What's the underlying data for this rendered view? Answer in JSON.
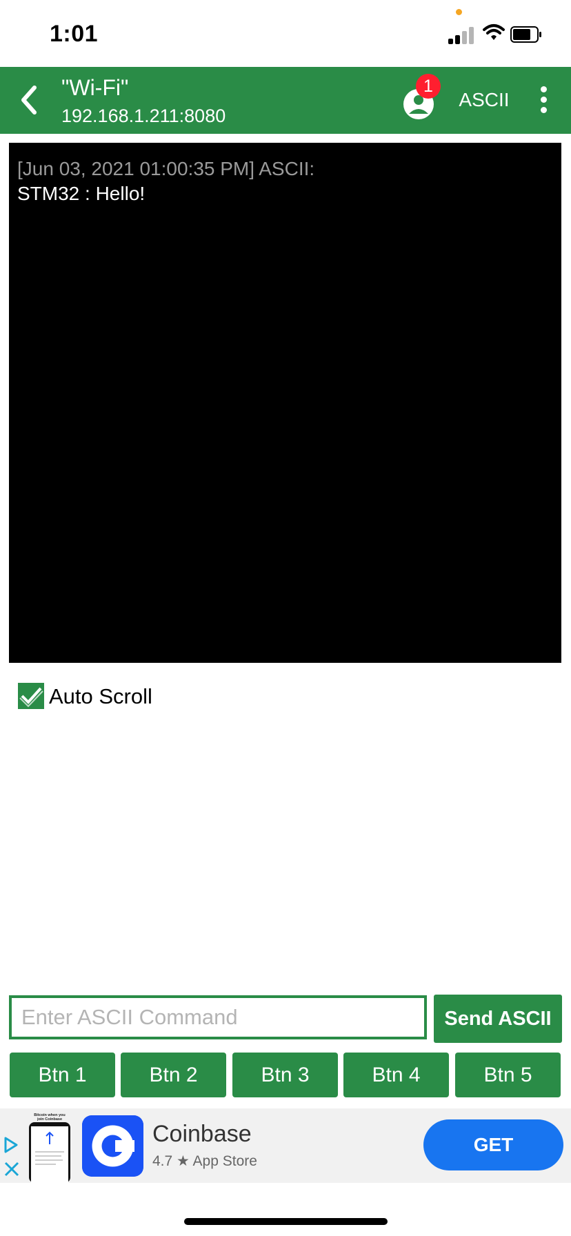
{
  "status_bar": {
    "time": "1:01"
  },
  "app_bar": {
    "title": "\"Wi-Fi\"",
    "subtitle": "192.168.1.211:8080",
    "badge_count": "1",
    "mode_label": "ASCII"
  },
  "terminal": {
    "entries": [
      {
        "header": "[Jun 03, 2021 01:00:35 PM] ASCII:",
        "message": "STM32 : Hello!"
      }
    ]
  },
  "auto_scroll": {
    "label": "Auto Scroll",
    "checked": true
  },
  "command": {
    "placeholder": "Enter ASCII Command",
    "value": "",
    "send_label": "Send ASCII"
  },
  "buttons": [
    "Btn 1",
    "Btn 2",
    "Btn 3",
    "Btn 4",
    "Btn 5"
  ],
  "ad": {
    "thumb_caption": "Bitcoin when you join Coinbase",
    "title": "Coinbase",
    "rating": "4.7 ★ App Store",
    "cta": "GET"
  },
  "colors": {
    "accent": "#2a8c47",
    "badge": "#ff1f2f",
    "ad_cta": "#1875f0",
    "coinbase": "#1a52f5"
  }
}
